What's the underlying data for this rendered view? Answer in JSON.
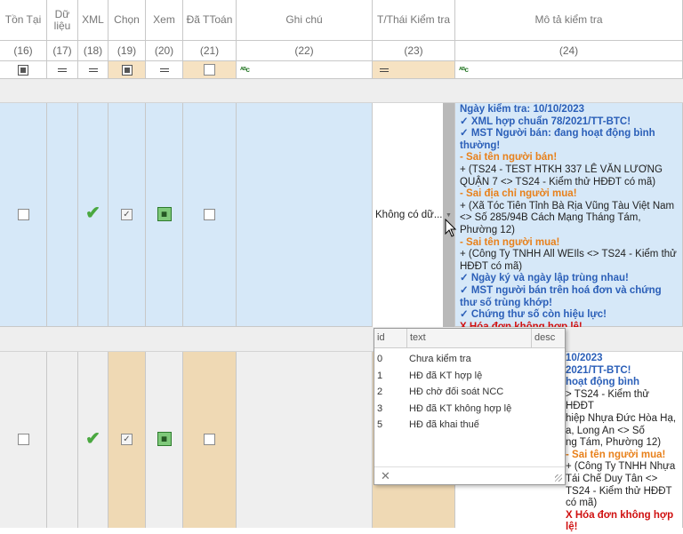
{
  "columns": {
    "ton_tai": {
      "label": "Tồn Tại",
      "num": "(16)"
    },
    "du_lieu": {
      "label": "Dữ liệu",
      "num": "(17)"
    },
    "xml": {
      "label": "XML",
      "num": "(18)"
    },
    "chon": {
      "label": "Chọn",
      "num": "(19)"
    },
    "xem": {
      "label": "Xem",
      "num": "(20)"
    },
    "da_ttoan": {
      "label": "Đã TToán",
      "num": "(21)"
    },
    "ghi_chu": {
      "label": "Ghi chú",
      "num": "(22)"
    },
    "tthai": {
      "label": "T/Thái Kiểm tra",
      "num": "(23)"
    },
    "mo_ta": {
      "label": "Mô tả kiểm tra",
      "num": "(24)"
    }
  },
  "row1": {
    "status_value": "Không có dữ...",
    "description": [
      {
        "style": "blue",
        "text": "Ngày kiểm tra: 10/10/2023"
      },
      {
        "style": "blue",
        "text": "✓ XML hợp chuẩn 78/2021/TT-BTC!"
      },
      {
        "style": "blue",
        "text": "✓ MST Người bán: đang hoạt động bình thường!"
      },
      {
        "style": "orange",
        "text": "- Sai tên người bán!"
      },
      {
        "style": "dark",
        "text": "+ (TS24 - TEST HTKH 337 LÊ VĂN LƯƠNG QUẬN 7 <> TS24 - Kiểm thử HĐĐT có mã)"
      },
      {
        "style": "orange",
        "text": "- Sai địa chỉ người mua!"
      },
      {
        "style": "dark",
        "text": "+ (Xã Tóc Tiên Tỉnh Bà Rịa Vũng Tàu Việt Nam <> Số 285/94B Cách Mạng Tháng Tám, Phường 12)"
      },
      {
        "style": "orange",
        "text": "- Sai tên người mua!"
      },
      {
        "style": "dark",
        "text": "+ (Công Ty TNHH All WEIls <> TS24 - Kiểm thử HĐĐT có mã)"
      },
      {
        "style": "blue",
        "text": "✓ Ngày ký và ngày lập trùng nhau!"
      },
      {
        "style": "blue",
        "text": "✓ MST người bán trên hoá đơn và chứng thư số trùng khớp!"
      },
      {
        "style": "blue",
        "text": "✓ Chứng thư số còn hiệu lực!"
      },
      {
        "style": "red",
        "text": "X Hóa đơn không hợp lệ!"
      }
    ]
  },
  "row2": {
    "description_visible": [
      {
        "style": "blue",
        "text": "10/2023"
      },
      {
        "style": "blue",
        "text": "2021/TT-BTC!"
      },
      {
        "style": "blue",
        "text": "hoạt động bình"
      },
      {
        "style": "dark",
        "text": "> TS24 - Kiểm thử HĐĐT"
      },
      {
        "style": "dark",
        "text": "hiệp Nhựa Đức Hòa Hạ,"
      },
      {
        "style": "dark",
        "text": "a, Long An <> Số"
      },
      {
        "style": "dark",
        "text": "ng Tám, Phường 12)"
      },
      {
        "style": "orange",
        "text": "- Sai tên người mua!"
      },
      {
        "style": "dark",
        "text": "+ (Công Ty TNHH Nhựa Tái Chế Duy Tân <> TS24 - Kiểm thử HĐĐT có mã)"
      },
      {
        "style": "red",
        "text": "X Hóa đơn không hợp lệ!"
      }
    ]
  },
  "dropdown": {
    "headers": {
      "id": "id",
      "text": "text",
      "desc": "desc"
    },
    "options": [
      {
        "id": "0",
        "text": "Chưa kiểm tra"
      },
      {
        "id": "1",
        "text": "HĐ đã KT hợp lệ"
      },
      {
        "id": "2",
        "text": "HĐ chờ đối soát NCC"
      },
      {
        "id": "3",
        "text": "HĐ đã KT không hợp lệ"
      },
      {
        "id": "5",
        "text": "HĐ đã khai thuế"
      }
    ],
    "close_glyph": "✕"
  },
  "icons": {
    "filter_text": "ᴬᴮc",
    "check": "✔",
    "tick": "✓"
  },
  "colors": {
    "selected_row": "#d6e8f8",
    "highlight_col": "#efd9b4",
    "blue_text": "#2b5fb8",
    "orange_text": "#e8801a",
    "red_text": "#d01010"
  }
}
